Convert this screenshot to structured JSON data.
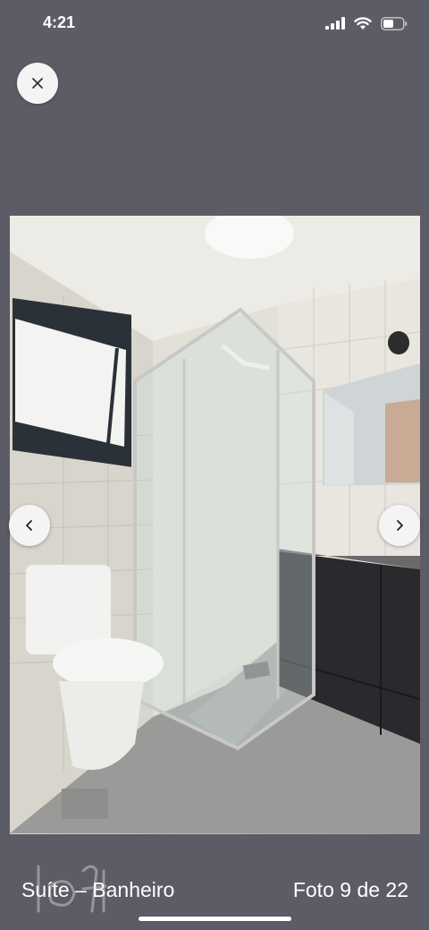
{
  "status_bar": {
    "time": "4:21",
    "icons": [
      "cellular-signal-icon",
      "wifi-icon",
      "battery-icon"
    ]
  },
  "close_button": {
    "icon": "close-icon"
  },
  "photo": {
    "description_icon": "bathroom-photo",
    "watermark_text": "Foter"
  },
  "navigation": {
    "prev_icon": "chevron-left-icon",
    "next_icon": "chevron-right-icon"
  },
  "footer": {
    "caption": "Suíte – Banheiro",
    "counter": "Foto 9 de 22"
  },
  "colors": {
    "background": "#5c5c66",
    "button_bg": "#f4f4f4",
    "text": "#ffffff"
  }
}
